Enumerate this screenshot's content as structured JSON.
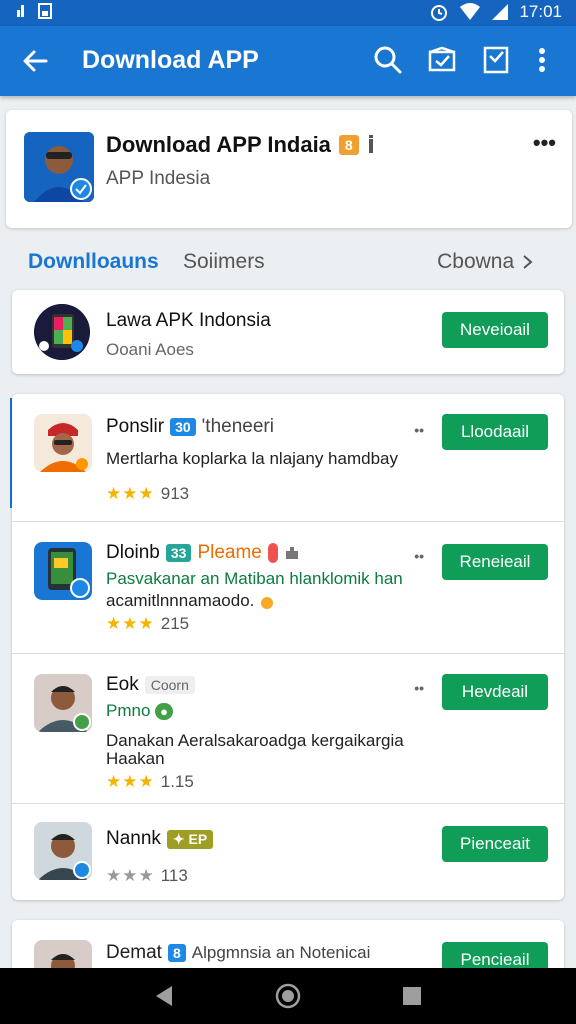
{
  "status": {
    "time": "17:01"
  },
  "appbar": {
    "title": "Download APP"
  },
  "header": {
    "name": "Download APP Indaia",
    "badge": "8",
    "subtitle": "APP Indesia"
  },
  "tabs": [
    {
      "label": "Downlloauns"
    },
    {
      "label": "Soiimers"
    }
  ],
  "tab_more": "Cbowna",
  "featured": {
    "title": "Lawa APK Indonsia",
    "subtitle": "Ooani Aoes",
    "button": "Neveioail"
  },
  "apps": [
    {
      "title": "Ponslir",
      "chip": "30",
      "extra": "'theneeri",
      "line1": "Mertlarha koplarka la nlajany hamdbay",
      "line2": "",
      "rating": "913",
      "button": "Lloodaail"
    },
    {
      "title": "Dloinb",
      "chip": "33",
      "extra": "Pleame",
      "line1": "Pasvakanar an Matiban hlanklomik han",
      "line2": "acamitlnnnamaodo.",
      "rating": "215",
      "button": "Reneieail"
    },
    {
      "title": "Eok",
      "chip": "Coorn",
      "extra": "Pmno",
      "line1": "Danakan Aeralsakaroadga kergaikargia",
      "line2": "Haakan",
      "rating": "1.15",
      "button": "Hevdeail"
    },
    {
      "title": "Nannk",
      "chip": "EP",
      "extra": "",
      "line1": "",
      "line2": "",
      "rating": "113",
      "button": "Pienceait"
    }
  ],
  "last": {
    "title": "Demat",
    "chip": "8",
    "text": "Alpgmnsia an Notenicai",
    "button": "Pencieail"
  },
  "colors": {
    "primary": "#1976d2",
    "status": "#1565c0",
    "button_green": "#0f9d58",
    "star": "#f4b400"
  }
}
